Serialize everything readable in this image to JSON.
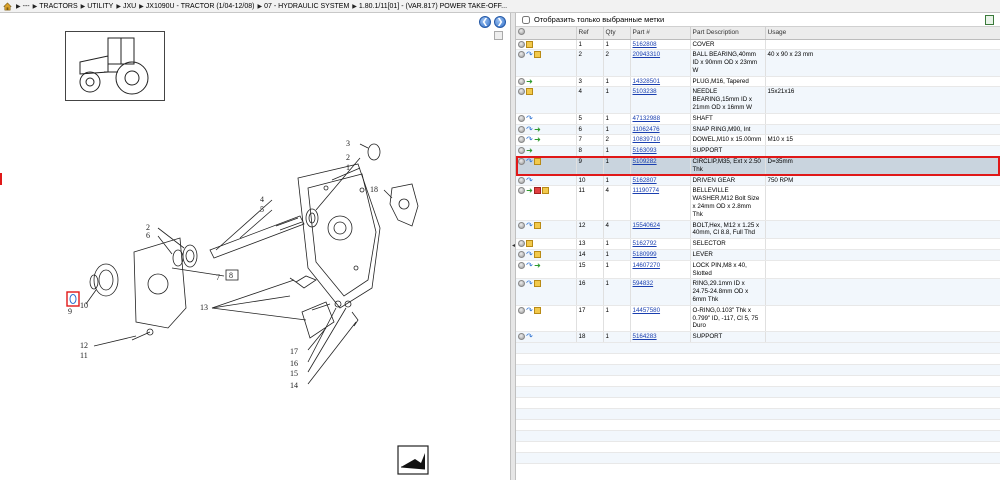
{
  "breadcrumb": {
    "items": [
      "---",
      "TRACTORS",
      "UTILITY",
      "JXU",
      "JX1090U - TRACTOR (1/04-12/08)",
      "07 - HYDRAULIC SYSTEM",
      "1.80.1/11[01] - (VAR.817) POWER TAKE-OFF..."
    ]
  },
  "filter": {
    "label": "Отобразить только выбранные метки"
  },
  "table": {
    "headers": {
      "ref": "Ref",
      "qty": "Qty",
      "part": "Part #",
      "desc": "Part Description",
      "usage": "Usage"
    },
    "rows": [
      {
        "icons": [
          "circle",
          "box"
        ],
        "ref": "1",
        "qty": "1",
        "part": "5162808",
        "desc": "COVER",
        "usage": ""
      },
      {
        "icons": [
          "circle",
          "arrow-blue",
          "box"
        ],
        "ref": "2",
        "qty": "2",
        "part": "20943310",
        "desc": "BALL BEARING,40mm ID x 90mm OD x 23mm W",
        "usage": "40 x 90 x 23 mm"
      },
      {
        "icons": [
          "circle",
          "arrow-green"
        ],
        "ref": "3",
        "qty": "1",
        "part": "14328501",
        "desc": "PLUG,M16, Tapered",
        "usage": ""
      },
      {
        "icons": [
          "circle",
          "box"
        ],
        "ref": "4",
        "qty": "1",
        "part": "5103238",
        "desc": "NEEDLE BEARING,15mm ID x 21mm OD x 16mm W",
        "usage": "15x21x16"
      },
      {
        "icons": [
          "circle",
          "arrow-blue"
        ],
        "ref": "5",
        "qty": "1",
        "part": "47132988",
        "desc": "SHAFT",
        "usage": ""
      },
      {
        "icons": [
          "circle",
          "arrow-blue",
          "arrow-green"
        ],
        "ref": "6",
        "qty": "1",
        "part": "11062476",
        "desc": "SNAP RING,M90, Int",
        "usage": ""
      },
      {
        "icons": [
          "circle",
          "arrow-blue",
          "arrow-green"
        ],
        "ref": "7",
        "qty": "2",
        "part": "10839710",
        "desc": "DOWEL,M10 x 15.00mm",
        "usage": "M10 x 15"
      },
      {
        "icons": [
          "circle",
          "arrow-green"
        ],
        "ref": "8",
        "qty": "1",
        "part": "5163093",
        "desc": "SUPPORT",
        "usage": ""
      },
      {
        "icons": [
          "circle",
          "arrow-blue",
          "box"
        ],
        "ref": "9",
        "qty": "1",
        "part": "5109282",
        "desc": "CIRCLIP,M35, Ext x 2.50 Thk",
        "usage": "D=35mm",
        "selected": true
      },
      {
        "icons": [
          "circle",
          "arrow-blue"
        ],
        "ref": "10",
        "qty": "1",
        "part": "5162807",
        "desc": "DRIVEN GEAR",
        "usage": "750 RPM"
      },
      {
        "icons": [
          "circle",
          "arrow-green",
          "red",
          "box"
        ],
        "ref": "11",
        "qty": "4",
        "part": "11190774",
        "desc": "BELLEVILLE WASHER,M12 Bolt Size x 24mm OD x 2.8mm Thk",
        "usage": ""
      },
      {
        "icons": [
          "circle",
          "arrow-blue",
          "box"
        ],
        "ref": "12",
        "qty": "4",
        "part": "15540624",
        "desc": "BOLT,Hex, M12 x 1.25 x 40mm, Cl 8.8, Full Thd",
        "usage": ""
      },
      {
        "icons": [
          "circle",
          "box"
        ],
        "ref": "13",
        "qty": "1",
        "part": "5162792",
        "desc": "SELECTOR",
        "usage": ""
      },
      {
        "icons": [
          "circle",
          "arrow-blue",
          "box"
        ],
        "ref": "14",
        "qty": "1",
        "part": "5180999",
        "desc": "LEVER",
        "usage": ""
      },
      {
        "icons": [
          "circle",
          "arrow-blue",
          "arrow-green"
        ],
        "ref": "15",
        "qty": "1",
        "part": "14607270",
        "desc": "LOCK PIN,M8 x 40, Slotted",
        "usage": ""
      },
      {
        "icons": [
          "circle",
          "arrow-blue",
          "box"
        ],
        "ref": "16",
        "qty": "1",
        "part": "594832",
        "desc": "RING,29.1mm ID x 24.75-24.8mm OD x 6mm Thk",
        "usage": ""
      },
      {
        "icons": [
          "circle",
          "arrow-blue",
          "box"
        ],
        "ref": "17",
        "qty": "1",
        "part": "14457580",
        "desc": "O-RING,0.103\" Thk x 0.799\" ID, -117, Cl 5, 75 Duro",
        "usage": ""
      },
      {
        "icons": [
          "circle",
          "arrow-blue"
        ],
        "ref": "18",
        "qty": "1",
        "part": "5164283",
        "desc": "SUPPORT",
        "usage": ""
      }
    ]
  },
  "diagram": {
    "callouts": [
      "1",
      "2",
      "3",
      "4",
      "5",
      "6",
      "7",
      "8",
      "9",
      "10",
      "11",
      "12",
      "13",
      "14",
      "15",
      "16",
      "17",
      "18"
    ]
  },
  "colors": {
    "selection": "#e01818",
    "link": "#1a3fb0",
    "row_alt": "#f2f7fc",
    "row_selected": "#c9d4de"
  }
}
